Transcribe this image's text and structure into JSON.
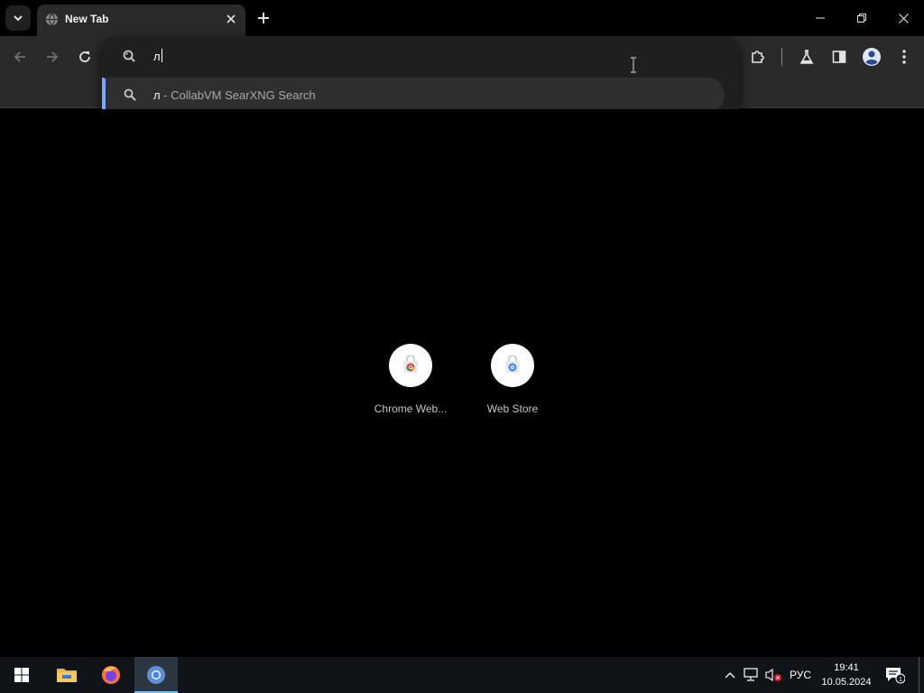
{
  "browser": {
    "tab_title": "New Tab",
    "omnibox_text": "л",
    "suggestion": {
      "query": "л",
      "separator": " - ",
      "engine": "CollabVM SearXNG Search"
    },
    "icons": {
      "tab_search": "chevron-down-icon",
      "favicon": "globe-icon",
      "tab_close": "close-icon",
      "new_tab": "plus-icon",
      "back": "arrow-left-icon",
      "forward": "arrow-right-icon",
      "reload": "reload-icon",
      "extensions": "puzzle-icon",
      "labs": "flask-icon",
      "side_panel": "side-panel-icon",
      "profile": "profile-icon",
      "menu": "kebab-menu-icon",
      "search": "search-icon"
    }
  },
  "ntp": {
    "shortcuts": [
      {
        "label": "Chrome Web..."
      },
      {
        "label": "Web Store"
      }
    ]
  },
  "taskbar": {
    "language": "РУС",
    "time": "19:41",
    "date": "10.05.2024",
    "notification_count": "1"
  },
  "colors": {
    "accent": "#7aa7ff",
    "toolbar": "#2a2a2a",
    "popup": "#1f1f1f"
  }
}
